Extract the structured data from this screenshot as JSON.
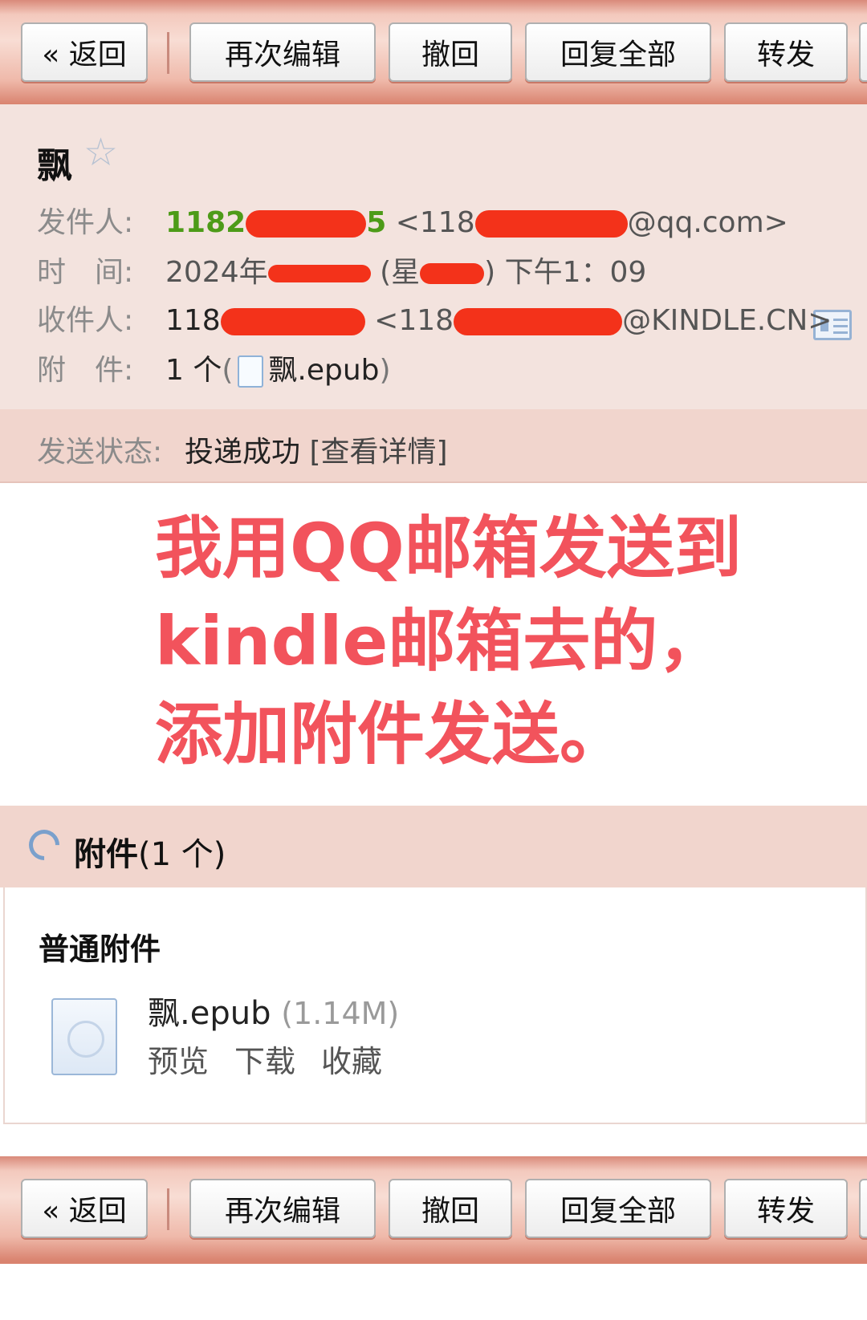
{
  "toolbar": {
    "back": "« 返回",
    "edit_again": "再次编辑",
    "recall": "撤回",
    "reply_all": "回复全部",
    "forward": "转发"
  },
  "mail": {
    "subject": "飘",
    "star": "☆",
    "sender_label": "发件人:",
    "sender_name_visible": "1182",
    "sender_name_tail": "5",
    "sender_email_prefix": "<118",
    "sender_email_suffix": "@qq.com>",
    "time_label": "时　间:",
    "time_prefix": "2024年",
    "time_mid": "(星",
    "time_mid2": ")",
    "time_suffix": "下午1：09",
    "recipient_label": "收件人:",
    "recipient_name_visible": "118",
    "recipient_email_prefix": "<118",
    "recipient_email_suffix": "@KINDLE.CN>",
    "attach_label": "附　件:",
    "attach_count": "1 个",
    "attach_paren_open": "(",
    "attach_name": "飘.epub",
    "attach_paren_close": ")",
    "status_label": "发送状态:",
    "status_value": "投递成功",
    "status_link": "[查看详情]"
  },
  "annotation": {
    "line1": "我用QQ邮箱发送到",
    "line2": "kindle邮箱去的，",
    "line3": "添加附件发送。"
  },
  "attachments": {
    "title_bold": "附件",
    "title_count": "(1 个)",
    "section": "普通附件",
    "file_name": "飘.epub",
    "file_size": "(1.14M)",
    "preview": "预览",
    "download": "下载",
    "save": "收藏"
  },
  "colors": {
    "annotation": "#f2535c",
    "redaction": "#f3321a",
    "sender_green": "#4d9b18",
    "header_bg": "#f3e3de",
    "toolbar_bg": "#efb9aa"
  }
}
